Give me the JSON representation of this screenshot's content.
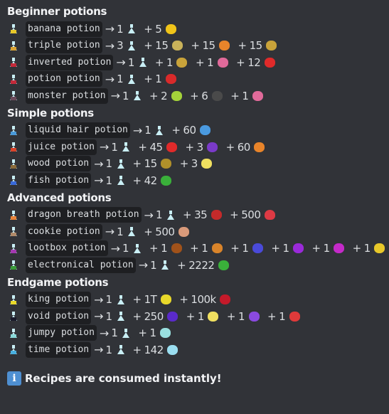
{
  "sections": [
    {
      "title": "Beginner potions",
      "recipes": [
        {
          "name": "banana potion",
          "icon": "banana-potion-icon",
          "icon_color": "#e8c82a",
          "output": "1",
          "ingredients": [
            {
              "qty": "5",
              "icon": "banana-icon",
              "color": "#f0c419"
            }
          ]
        },
        {
          "name": "triple potion",
          "icon": "triple-potion-icon",
          "icon_color": "#d9a334",
          "output": "3",
          "ingredients": [
            {
              "qty": "15",
              "icon": "bread-icon",
              "color": "#c9b25a"
            },
            {
              "qty": "15",
              "icon": "carrot-icon",
              "color": "#e8842a"
            },
            {
              "qty": "15",
              "icon": "potato-icon",
              "color": "#c9a33a"
            }
          ]
        },
        {
          "name": "inverted potion",
          "icon": "inverted-potion-icon",
          "icon_color": "#c42a3a",
          "output": "1",
          "ingredients": [
            {
              "qty": "1",
              "icon": "potato-icon",
              "color": "#c9a33a"
            },
            {
              "qty": "1",
              "icon": "worm-icon",
              "color": "#e06a9a"
            },
            {
              "qty": "12",
              "icon": "apple-icon",
              "color": "#e02a2a"
            }
          ]
        },
        {
          "name": "potion potion",
          "icon": "potion-potion-icon",
          "icon_color": "#c42a3a",
          "output": "1",
          "ingredients": [
            {
              "qty": "1",
              "icon": "red-potion-icon",
              "color": "#d92a2a"
            }
          ]
        },
        {
          "name": "monster potion",
          "icon": "monster-potion-icon",
          "icon_color": "#6a4a5a",
          "output": "1",
          "ingredients": [
            {
              "qty": "2",
              "icon": "slime-cube-icon",
              "color": "#a4d23a"
            },
            {
              "qty": "6",
              "icon": "bat-icon",
              "color": "#4a4a4a"
            },
            {
              "qty": "1",
              "icon": "worm-icon",
              "color": "#e06a9a"
            }
          ]
        }
      ]
    },
    {
      "title": "Simple potions",
      "recipes": [
        {
          "name": "liquid hair potion",
          "icon": "liquid-hair-potion-icon",
          "icon_color": "#4a9ad9",
          "output": "1",
          "ingredients": [
            {
              "qty": "60",
              "icon": "hair-icon",
              "color": "#4a9ae0"
            }
          ]
        },
        {
          "name": "juice potion",
          "icon": "juice-potion-icon",
          "icon_color": "#d9432a",
          "output": "1",
          "ingredients": [
            {
              "qty": "45",
              "icon": "apple-icon",
              "color": "#e02a2a"
            },
            {
              "qty": "3",
              "icon": "grape-icon",
              "color": "#7a3ac9"
            },
            {
              "qty": "60",
              "icon": "carrot-icon",
              "color": "#e8842a"
            }
          ]
        },
        {
          "name": "wood potion",
          "icon": "wood-potion-icon",
          "icon_color": "#8a6a3a",
          "output": "1",
          "ingredients": [
            {
              "qty": "15",
              "icon": "golden-log-icon",
              "color": "#b0902a"
            },
            {
              "qty": "3",
              "icon": "golden-seed-icon",
              "color": "#f0e060"
            }
          ]
        },
        {
          "name": "fish potion",
          "icon": "fish-potion-icon",
          "icon_color": "#3a6ad9",
          "output": "1",
          "ingredients": [
            {
              "qty": "42",
              "icon": "fish-icon",
              "color": "#3ab03a"
            }
          ]
        }
      ]
    },
    {
      "title": "Advanced potions",
      "recipes": [
        {
          "name": "dragon breath potion",
          "icon": "dragon-breath-potion-icon",
          "icon_color": "#e8843a",
          "output": "1",
          "ingredients": [
            {
              "qty": "35",
              "icon": "dragon-scale-icon",
              "color": "#c42a2a"
            },
            {
              "qty": "500",
              "icon": "heart-icon",
              "color": "#dd3a44"
            }
          ]
        },
        {
          "name": "cookie potion",
          "icon": "cookie-potion-icon",
          "icon_color": "#b08a6a",
          "output": "1",
          "ingredients": [
            {
              "qty": "500",
              "icon": "cookie-icon",
              "color": "#d99a7a"
            }
          ]
        },
        {
          "name": "lootbox potion",
          "icon": "lootbox-potion-icon",
          "icon_color": "#a43ab0",
          "output": "1",
          "ingredients": [
            {
              "qty": "1",
              "icon": "common-lootbox-icon",
              "color": "#a0521a"
            },
            {
              "qty": "1",
              "icon": "uncommon-lootbox-icon",
              "color": "#d9842a"
            },
            {
              "qty": "1",
              "icon": "rare-lootbox-icon",
              "color": "#4a4ad9"
            },
            {
              "qty": "1",
              "icon": "epic-lootbox-icon",
              "color": "#9a2ad9"
            },
            {
              "qty": "1",
              "icon": "edgy-lootbox-icon",
              "color": "#c42ac9"
            },
            {
              "qty": "1",
              "icon": "omega-lootbox-icon",
              "color": "#e8c82a"
            }
          ]
        },
        {
          "name": "electronical potion",
          "icon": "electronical-potion-icon",
          "icon_color": "#3a9a3a",
          "output": "1",
          "ingredients": [
            {
              "qty": "2222",
              "icon": "circuit-icon",
              "color": "#3ab03a"
            }
          ]
        }
      ]
    },
    {
      "title": "Endgame potions",
      "recipes": [
        {
          "name": "king potion",
          "icon": "king-potion-icon",
          "icon_color": "#e8d82a",
          "output": "1",
          "ingredients": [
            {
              "qty": "1T",
              "icon": "coin-icon",
              "color": "#e8d82a"
            },
            {
              "qty": "100k",
              "icon": "ruby-icon",
              "color": "#c41a2a"
            }
          ]
        },
        {
          "name": "void potion",
          "icon": "void-potion-icon",
          "icon_color": "#1a1a2a",
          "output": "1",
          "ingredients": [
            {
              "qty": "250",
              "icon": "void-orb-icon",
              "color": "#5a2ac9"
            },
            {
              "qty": "1",
              "icon": "golden-seed-icon",
              "color": "#f0e060"
            },
            {
              "qty": "1",
              "icon": "purple-worm-icon",
              "color": "#8a4ae0"
            },
            {
              "qty": "1",
              "icon": "watermelon-icon",
              "color": "#e03a3a"
            }
          ]
        },
        {
          "name": "jumpy potion",
          "icon": "jumpy-potion-icon",
          "icon_color": "#8ad9d9",
          "output": "1",
          "ingredients": [
            {
              "qty": "1",
              "icon": "spring-icon",
              "color": "#9ae0e0"
            }
          ]
        },
        {
          "name": "time potion",
          "icon": "time-potion-icon",
          "icon_color": "#4ab0e0",
          "output": "1",
          "ingredients": [
            {
              "qty": "142",
              "icon": "time-stone-icon",
              "color": "#9adef0"
            }
          ]
        }
      ]
    }
  ],
  "arrow": "→",
  "plus": "+",
  "potion_output_icon": "flask-icon",
  "footer": {
    "icon": "info-icon",
    "icon_glyph": "i",
    "text": "Recipes are consumed instantly!"
  }
}
